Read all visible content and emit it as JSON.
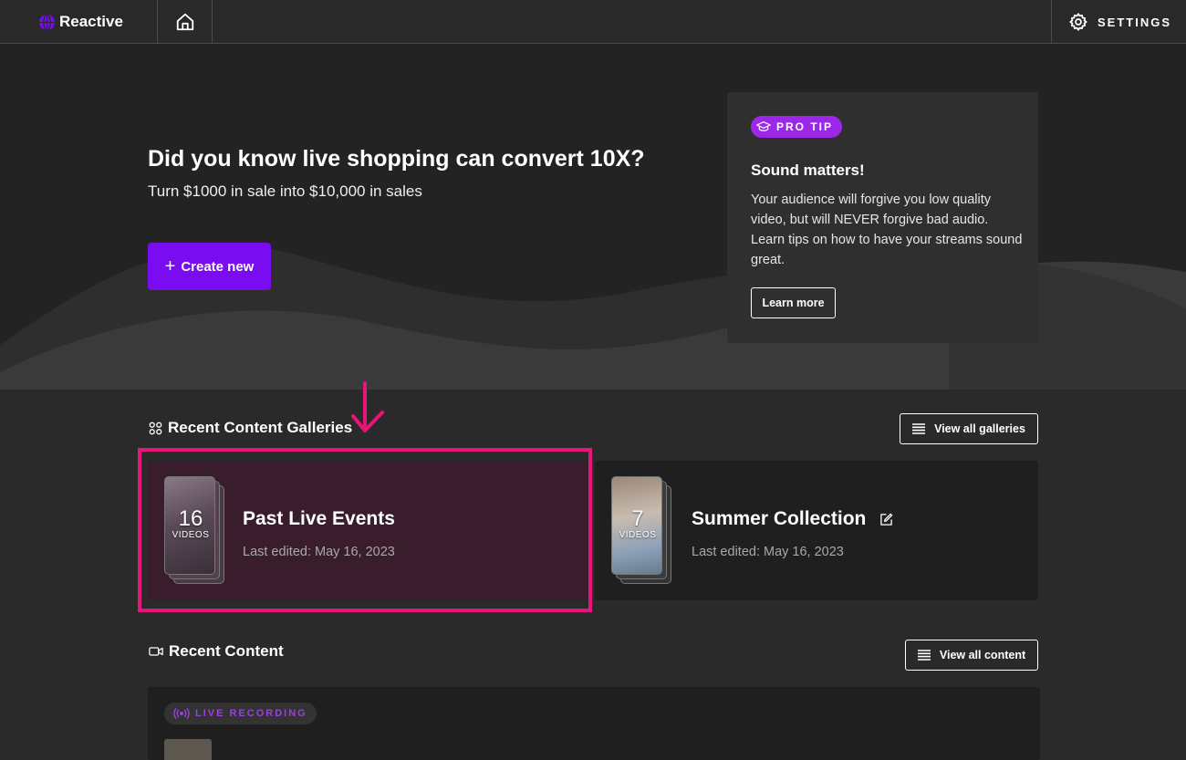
{
  "topbar": {
    "brand": "Reactive",
    "settings_label": "SETTINGS"
  },
  "hero": {
    "title": "Did you know live shopping can convert 10X?",
    "subtitle": "Turn $1000 in sale into $10,000 in sales",
    "create_label": "Create new"
  },
  "pro_tip": {
    "badge": "PRO TIP",
    "title": "Sound matters!",
    "body": "Your audience will forgive you low quality video, but will NEVER forgive bad audio. Learn tips on how to have your streams sound great.",
    "cta": "Learn more"
  },
  "galleries": {
    "title": "Recent Content Galleries",
    "view_all": "View all galleries",
    "items": [
      {
        "name": "Past Live Events",
        "count": "16",
        "unit": "VIDEOS",
        "edited": "Last edited: May 16, 2023"
      },
      {
        "name": "Summer Collection",
        "count": "7",
        "unit": "VIDEOS",
        "edited": "Last edited: May 16, 2023"
      }
    ]
  },
  "recent_content": {
    "title": "Recent Content",
    "view_all": "View all content",
    "items": [
      {
        "badge": "LIVE RECORDING"
      }
    ]
  },
  "colors": {
    "accent": "#7a0cf0",
    "pro_tip_badge": "#9c27e8",
    "highlight": "#e8147a",
    "background": "#2a2a2a"
  }
}
